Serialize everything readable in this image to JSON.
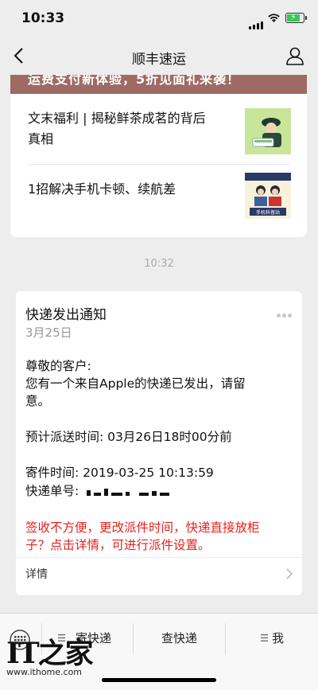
{
  "status_bar": {
    "time": "10:33"
  },
  "nav": {
    "title": "顺丰速运"
  },
  "articles": {
    "banner_text": "运费支付新体验，5折见面礼来袭！",
    "items": [
      {
        "title_line1": "文末福利 | 揭秘鲜茶成茗的背后",
        "title_line2": "真相"
      },
      {
        "title_line1": "1招解决手机卡顿、续航差",
        "thumb_caption": "手机科普站"
      }
    ]
  },
  "chat_time": "10:32",
  "notice": {
    "title": "快递发出通知",
    "date": "3月25日",
    "greeting": "尊敬的客户:",
    "body_line1": "您有一个来自Apple的快递已发出，请留",
    "body_line2": "意。",
    "eta_label": "预计派送时间:",
    "eta_value": "03月26日18时00分前",
    "send_time_label": "寄件时间:",
    "send_time_value": "2019-03-25 10:13:59",
    "tracking_label": "快递单号:",
    "tip_line1": "签收不方便，更改派件时间，快递直接放柜",
    "tip_line2": "子？点击详情，可进行派件设置。",
    "details_label": "详情",
    "accent_color": "#e3231f"
  },
  "tabbar": {
    "items": [
      {
        "label": "寄快递"
      },
      {
        "label": "查快递"
      },
      {
        "label": "我"
      }
    ]
  },
  "watermark": {
    "logo": "IT之家",
    "url": "www.ithome.com"
  }
}
